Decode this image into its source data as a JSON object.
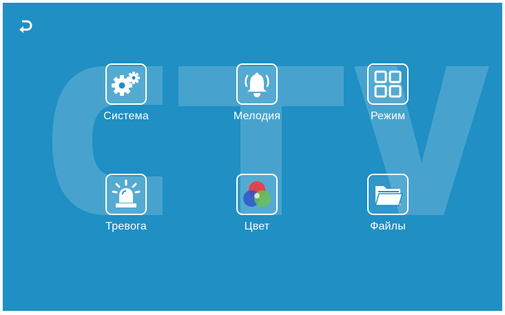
{
  "header": {
    "back_icon": "back-arrow-icon"
  },
  "watermark": {
    "text": "CTV"
  },
  "menu": {
    "items": [
      {
        "label": "Система",
        "icon": "gears-icon"
      },
      {
        "label": "Мелодия",
        "icon": "bell-icon"
      },
      {
        "label": "Режим",
        "icon": "grid-icon"
      },
      {
        "label": "Тревога",
        "icon": "alarm-icon"
      },
      {
        "label": "Цвет",
        "icon": "color-icon"
      },
      {
        "label": "Файлы",
        "icon": "folder-icon"
      }
    ]
  },
  "colors": {
    "background": "#1f8fc4",
    "icon_tile_border": "#ffffff",
    "text": "#ffffff"
  }
}
